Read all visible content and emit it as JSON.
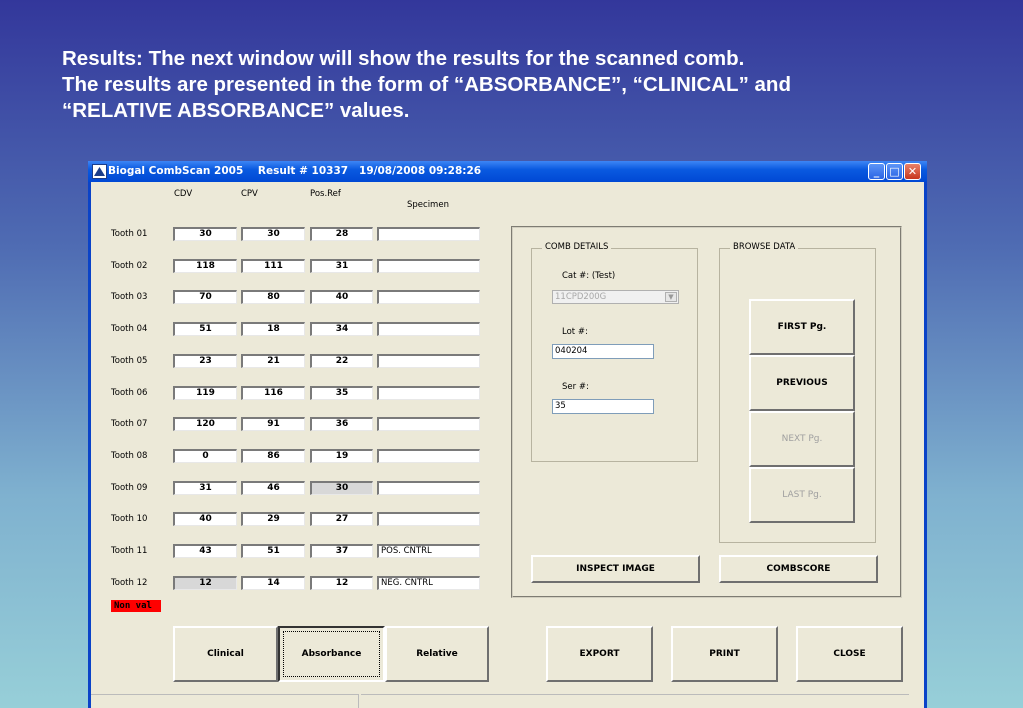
{
  "caption": {
    "line1": "Results: The next window will show the results for the scanned comb.",
    "line2": "The results are presented in the form of “ABSORBANCE”, “CLINICAL” and",
    "line3": "“RELATIVE ABSORBANCE” values."
  },
  "window": {
    "title": "Biogal CombScan 2005    Result # 10337   19/08/2008 09:28:26",
    "minimize": "_",
    "maximize": "□",
    "close": "✕"
  },
  "headers": {
    "cdv": "CDV",
    "cpv": "CPV",
    "posref": "Pos.Ref",
    "specimen": "Specimen"
  },
  "rows": [
    {
      "label": "Tooth 01",
      "cdv": "30",
      "cpv": "30",
      "pos": "28",
      "spec": ""
    },
    {
      "label": "Tooth 02",
      "cdv": "118",
      "cpv": "111",
      "pos": "31",
      "spec": ""
    },
    {
      "label": "Tooth 03",
      "cdv": "70",
      "cpv": "80",
      "pos": "40",
      "spec": ""
    },
    {
      "label": "Tooth 04",
      "cdv": "51",
      "cpv": "18",
      "pos": "34",
      "spec": ""
    },
    {
      "label": "Tooth 05",
      "cdv": "23",
      "cpv": "21",
      "pos": "22",
      "spec": ""
    },
    {
      "label": "Tooth 06",
      "cdv": "119",
      "cpv": "116",
      "pos": "35",
      "spec": ""
    },
    {
      "label": "Tooth 07",
      "cdv": "120",
      "cpv": "91",
      "pos": "36",
      "spec": ""
    },
    {
      "label": "Tooth 08",
      "cdv": "0",
      "cpv": "86",
      "pos": "19",
      "spec": ""
    },
    {
      "label": "Tooth 09",
      "cdv": "31",
      "cpv": "46",
      "pos": "30",
      "spec": ""
    },
    {
      "label": "Tooth 10",
      "cdv": "40",
      "cpv": "29",
      "pos": "27",
      "spec": ""
    },
    {
      "label": "Tooth 11",
      "cdv": "43",
      "cpv": "51",
      "pos": "37",
      "spec": "POS. CNTRL"
    },
    {
      "label": "Tooth 12",
      "cdv": "12",
      "cpv": "14",
      "pos": "12",
      "spec": "NEG. CNTRL"
    }
  ],
  "nonval_label": "Non val",
  "comb_details": {
    "group_label": "COMB DETAILS",
    "cat_label": "Cat #: (Test)",
    "cat_value": "11CPD200G",
    "lot_label": "Lot #:",
    "lot_value": "040204",
    "ser_label": "Ser #:",
    "ser_value": "35"
  },
  "browse": {
    "group_label": "BROWSE DATA",
    "first": "FIRST Pg.",
    "previous": "PREVIOUS",
    "next": "NEXT Pg.",
    "last": "LAST Pg."
  },
  "actions": {
    "inspect": "INSPECT IMAGE",
    "combscore": "COMBSCORE",
    "clinical": "Clinical",
    "absorbance": "Absorbance",
    "relative": "Relative",
    "export": "EXPORT",
    "print": "PRINT",
    "close": "CLOSE"
  }
}
